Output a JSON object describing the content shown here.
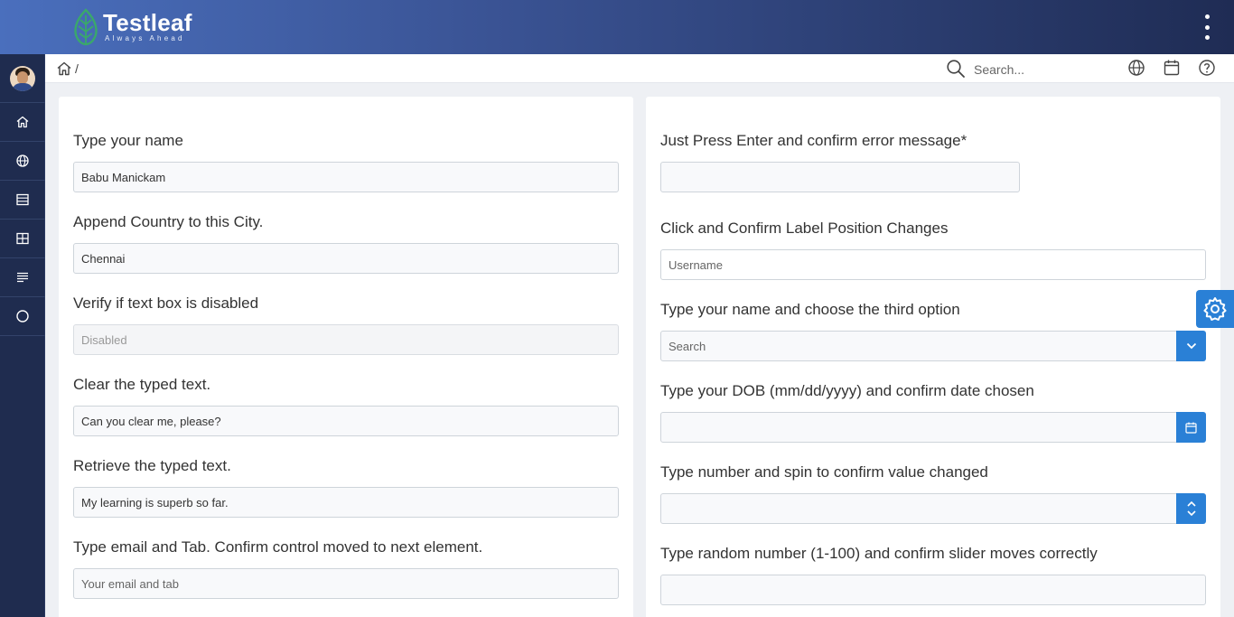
{
  "brand": {
    "name": "Testleaf",
    "tagline": "Always Ahead"
  },
  "breadcrumb": {
    "separator": "/"
  },
  "search": {
    "placeholder": "Search..."
  },
  "left": {
    "name": {
      "label": "Type your name",
      "value": "Babu Manickam"
    },
    "city": {
      "label": "Append Country to this City.",
      "value": "Chennai"
    },
    "disabled": {
      "label": "Verify if text box is disabled",
      "placeholder": "Disabled"
    },
    "clear": {
      "label": "Clear the typed text.",
      "value": "Can you clear me, please?"
    },
    "retrieve": {
      "label": "Retrieve the typed text.",
      "value": "My learning is superb so far."
    },
    "email": {
      "label": "Type email and Tab. Confirm control moved to next element.",
      "placeholder": "Your email and tab"
    }
  },
  "right": {
    "enter": {
      "label": "Just Press Enter and confirm error message*",
      "value": ""
    },
    "username": {
      "label": "Click and Confirm Label Position Changes",
      "placeholder": "Username"
    },
    "autocomplete": {
      "label": "Type your name and choose the third option",
      "placeholder": "Search"
    },
    "dob": {
      "label": "Type your DOB (mm/dd/yyyy) and confirm date chosen",
      "value": ""
    },
    "spinner": {
      "label": "Type number and spin to confirm value changed",
      "value": ""
    },
    "slider": {
      "label": "Type random number (1-100) and confirm slider moves correctly",
      "value": ""
    }
  },
  "colors": {
    "accent": "#2a80d6",
    "sidebar": "#1f2c4f",
    "header_start": "#4a6fbd",
    "header_end": "#1f2c54",
    "logo_green": "#3aa86b"
  }
}
